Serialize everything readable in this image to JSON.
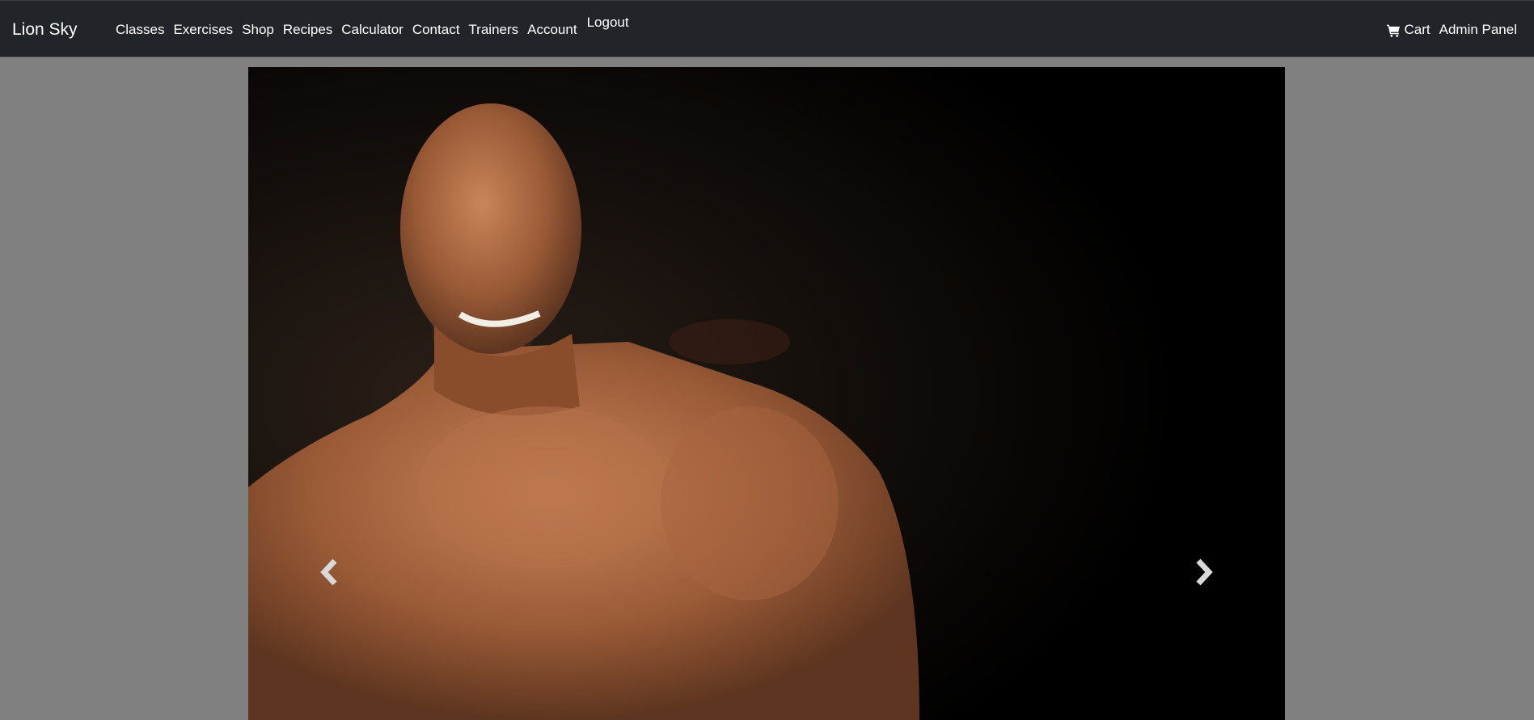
{
  "navbar": {
    "brand": "Lion Sky",
    "links": [
      {
        "label": "Classes"
      },
      {
        "label": "Exercises"
      },
      {
        "label": "Shop"
      },
      {
        "label": "Recipes"
      },
      {
        "label": "Calculator"
      },
      {
        "label": "Contact"
      },
      {
        "label": "Trainers"
      },
      {
        "label": "Account"
      }
    ],
    "logout_label": "Logout",
    "cart_label": "Cart",
    "admin_label": "Admin Panel"
  },
  "carousel": {
    "prev_icon": "chevron-left-icon",
    "next_icon": "chevron-right-icon"
  },
  "colors": {
    "navbar_bg": "#212529",
    "page_bg": "#808080",
    "carousel_bg": "#000000",
    "text": "#ffffff"
  }
}
